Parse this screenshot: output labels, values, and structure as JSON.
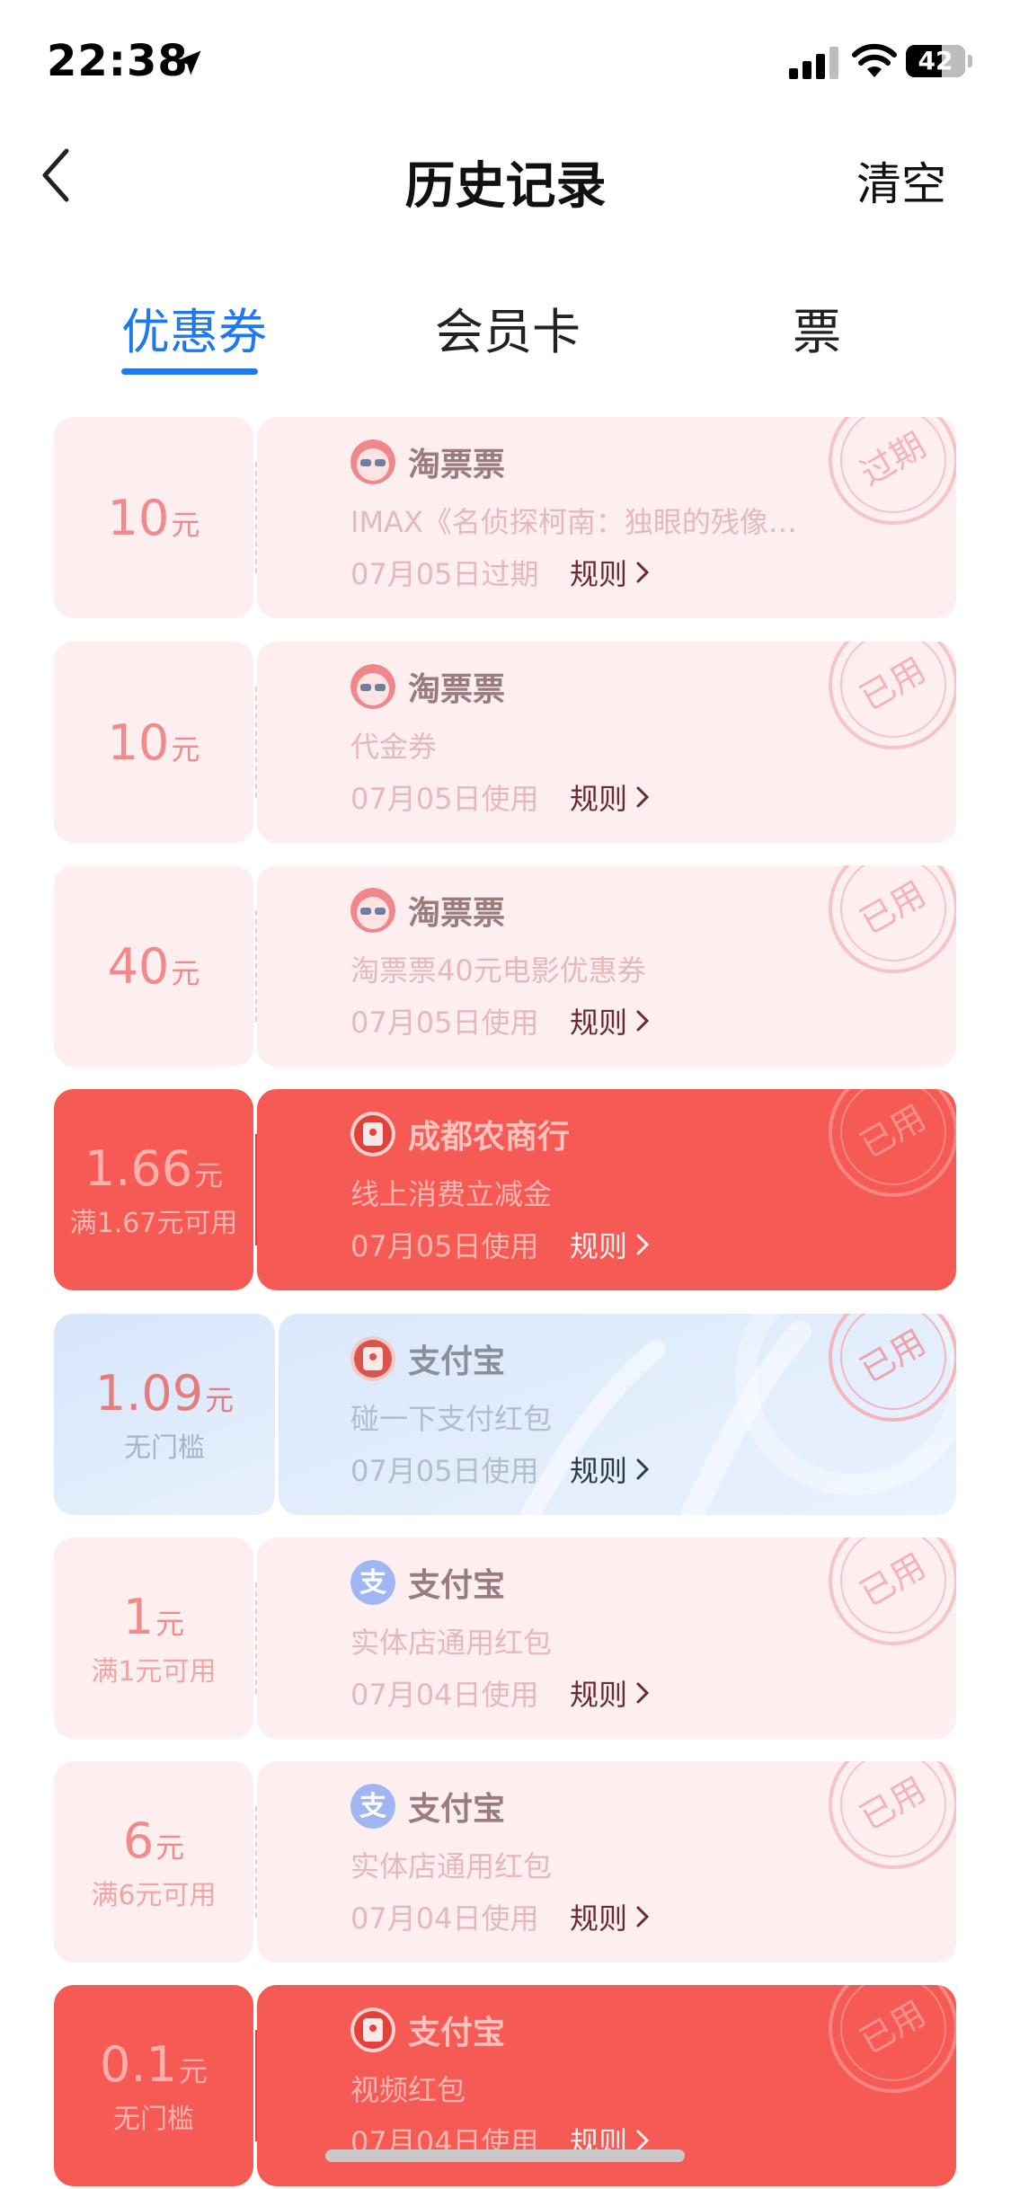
{
  "status_bar": {
    "time": "22:38",
    "battery": "42"
  },
  "nav": {
    "title": "历史记录",
    "clear": "清空"
  },
  "tabs": [
    {
      "label": "优惠券",
      "active": true
    },
    {
      "label": "会员卡",
      "active": false
    },
    {
      "label": "票",
      "active": false
    }
  ],
  "coupons": [
    {
      "amount": "10",
      "unit": "元",
      "condition": "",
      "merchant": "淘票票",
      "logo": "taopiaopiao-icon",
      "desc": "IMAX《名侦探柯南：独眼的残像…",
      "date": "07月05日过期",
      "rule": "规则",
      "stamp": "过期",
      "style": "pink"
    },
    {
      "amount": "10",
      "unit": "元",
      "condition": "",
      "merchant": "淘票票",
      "logo": "taopiaopiao-icon",
      "desc": "代金券",
      "date": "07月05日使用",
      "rule": "规则",
      "stamp": "已用",
      "style": "pink"
    },
    {
      "amount": "40",
      "unit": "元",
      "condition": "",
      "merchant": "淘票票",
      "logo": "taopiaopiao-icon",
      "desc": "淘票票40元电影优惠券",
      "date": "07月05日使用",
      "rule": "规则",
      "stamp": "已用",
      "style": "pink"
    },
    {
      "amount": "1.66",
      "unit": "元",
      "condition": "满1.67元可用",
      "merchant": "成都农商行",
      "logo": "red-packet-icon",
      "desc": "线上消费立减金",
      "date": "07月05日使用",
      "rule": "规则",
      "stamp": "已用",
      "style": "red"
    },
    {
      "amount": "1.09",
      "unit": "元",
      "condition": "无门槛",
      "merchant": "支付宝",
      "logo": "red-packet-icon",
      "desc": "碰一下支付红包",
      "date": "07月05日使用",
      "rule": "规则",
      "stamp": "已用",
      "style": "blue"
    },
    {
      "amount": "1",
      "unit": "元",
      "condition": "满1元可用",
      "merchant": "支付宝",
      "logo": "alipay-icon",
      "desc": "实体店通用红包",
      "date": "07月04日使用",
      "rule": "规则",
      "stamp": "已用",
      "style": "pink"
    },
    {
      "amount": "6",
      "unit": "元",
      "condition": "满6元可用",
      "merchant": "支付宝",
      "logo": "alipay-icon",
      "desc": "实体店通用红包",
      "date": "07月04日使用",
      "rule": "规则",
      "stamp": "已用",
      "style": "pink"
    },
    {
      "amount": "0.1",
      "unit": "元",
      "condition": "无门槛",
      "merchant": "支付宝",
      "logo": "red-packet-icon",
      "desc": "视频红包",
      "date": "07月04日使用",
      "rule": "规则",
      "stamp": "已用",
      "style": "red"
    }
  ],
  "colors": {
    "accent": "#1e78ee",
    "coupon_red": "#f65a55",
    "coupon_pink": "#fdeef0",
    "coupon_blue": "#dbe8fb"
  }
}
